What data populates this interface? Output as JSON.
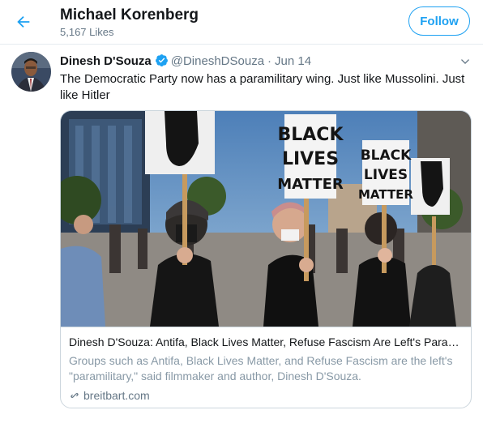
{
  "header": {
    "title": "Michael Korenberg",
    "subtitle": "5,167 Likes",
    "follow_label": "Follow"
  },
  "tweet": {
    "author_name": "Dinesh D'Souza",
    "handle": "@DineshDSouza",
    "separator": "·",
    "date": "Jun 14",
    "text": "The Democratic Party now has a paramilitary wing. Just like Mussolini. Just like Hitler",
    "verified": true
  },
  "card": {
    "title": "Dinesh D'Souza: Antifa, Black Lives Matter, Refuse Fascism Are Left's Paramilitary",
    "description": "Groups such as Antifa, Black Lives Matter, and Refuse Fascism are the left's \"paramilitary,\" said filmmaker and author, Dinesh D'Souza.",
    "domain": "breitbart.com",
    "sign_1": [
      "BLACK",
      "LIVES",
      "MATTER"
    ],
    "sign_2": [
      "BLACK",
      "LIVES",
      "MATTER"
    ]
  },
  "icons": {
    "back": "arrow-left-icon",
    "verified": "verified-badge-icon",
    "more": "chevron-down-icon",
    "link": "link-icon"
  },
  "colors": {
    "accent": "#1da1f2",
    "secondary_text": "#657786",
    "border": "#e6ecf0"
  }
}
